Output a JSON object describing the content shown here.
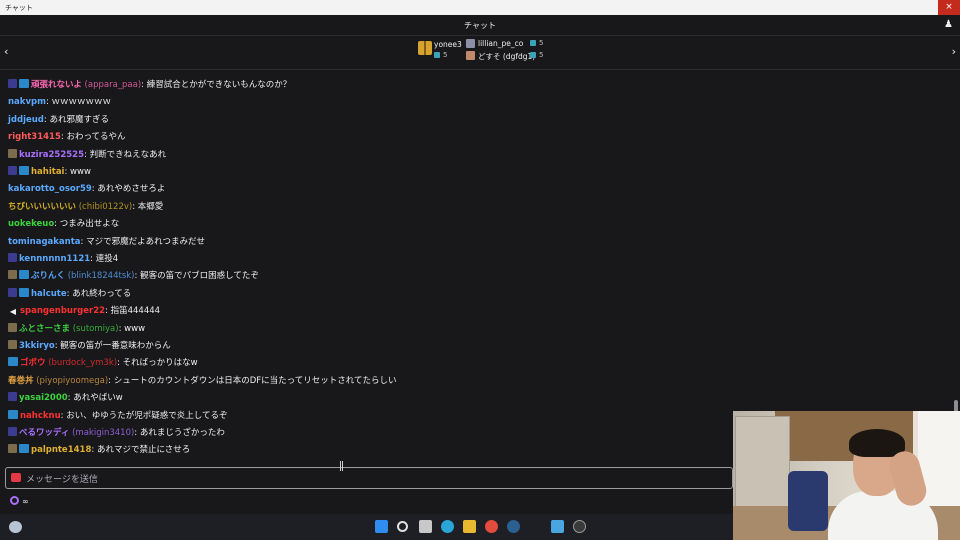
{
  "window": {
    "title": "チャット",
    "close_glyph": "×"
  },
  "header": {
    "title": "チャット",
    "users_icon": "users-icon"
  },
  "gift_bar": {
    "left_arrow": "‹",
    "right_arrow": "›",
    "gifters": [
      {
        "name": "yonee3",
        "count": "5"
      },
      {
        "name": "lillian_pe_co",
        "count": "5"
      },
      {
        "name": "どすそ (dgfdg1)",
        "count": "5"
      }
    ]
  },
  "messages": [
    {
      "user": "頑張れないよ",
      "sub": "(appara_paa)",
      "text": "練習試合とかができないもんなのか？",
      "color": "#ff69b4",
      "badges": [
        "sub-badge",
        "prime"
      ]
    },
    {
      "user": "nakvpm",
      "sub": "",
      "text": "ｗｗｗｗｗｗｗ",
      "color": "#5aa9ff",
      "badges": []
    },
    {
      "user": "jddjeud",
      "sub": "",
      "text": "あれ邪魔すぎる",
      "color": "#5aa9ff",
      "badges": []
    },
    {
      "user": "right31415",
      "sub": "",
      "text": "おわってるやん",
      "color": "#ff5a5a",
      "badges": []
    },
    {
      "user": "kuzira252525",
      "sub": "",
      "text": "判断できねえなあれ",
      "color": "#a970ff",
      "badges": [
        "img"
      ]
    },
    {
      "user": "hahitai",
      "sub": "",
      "text": "www",
      "color": "#e0b030",
      "badges": [
        "sub-badge",
        "prime"
      ]
    },
    {
      "user": "kakarotto_osor59",
      "sub": "",
      "text": "あれやめさせろよ",
      "color": "#5aa9ff",
      "badges": []
    },
    {
      "user": "ちびいいいいいい",
      "sub": "(chibi0122v)",
      "text": "本郷愛",
      "color": "#d4b020",
      "badges": []
    },
    {
      "user": "uokekeuo",
      "sub": "",
      "text": "つまみ出せよな",
      "color": "#3ed13e",
      "badges": []
    },
    {
      "user": "tominagakanta",
      "sub": "",
      "text": "マジで邪魔だよあれつまみだせ",
      "color": "#5aa9ff",
      "badges": []
    },
    {
      "user": "kennnnnn1121",
      "sub": "",
      "text": "連投4",
      "color": "#5aa9ff",
      "badges": [
        "sub-badge"
      ]
    },
    {
      "user": "ぶりんく",
      "sub": "(blink18244tsk)",
      "text": "観客の笛でパブロ困惑してたぞ",
      "color": "#5aa9ff",
      "badges": [
        "img",
        "prime"
      ]
    },
    {
      "user": "halcute",
      "sub": "",
      "text": "あれ終わってる",
      "color": "#5aa9ff",
      "badges": [
        "sub-badge",
        "prime"
      ]
    },
    {
      "user": "spangenburger22",
      "sub": "",
      "text": "指笛444444",
      "color": "#ff3030",
      "badges": [
        "speaker"
      ]
    },
    {
      "user": "ふとさーさま",
      "sub": "(sutomiya)",
      "text": "www",
      "color": "#3ed13e",
      "badges": [
        "img"
      ]
    },
    {
      "user": "3kkiryo",
      "sub": "",
      "text": "観客の笛が一番意味わからん",
      "color": "#5aa9ff",
      "badges": [
        "img"
      ]
    },
    {
      "user": "ゴボウ",
      "sub": "(burdock_ym3k)",
      "text": "そればっかりはなw",
      "color": "#ff3030",
      "badges": [
        "prime"
      ]
    },
    {
      "user": "春巻丼",
      "sub": "(piyopiyoomega)",
      "text": "シュートのカウントダウンは日本のDFに当たってリセットされてたらしい",
      "color": "#e0a040",
      "badges": []
    },
    {
      "user": "yasai2000",
      "sub": "",
      "text": "あれやばいw",
      "color": "#3ed13e",
      "badges": [
        "sub-badge"
      ]
    },
    {
      "user": "nahcknu",
      "sub": "",
      "text": "おい、ゆゆうたが児ポ疑惑で炎上してるぞ",
      "color": "#ff3030",
      "badges": [
        "prime"
      ]
    },
    {
      "user": "べるワッディ",
      "sub": "(makigin3410)",
      "text": "あれまじうざかったわ",
      "color": "#a970ff",
      "badges": [
        "sub-badge"
      ]
    },
    {
      "user": "palpnte1418",
      "sub": "",
      "text": "あれマジで禁止にさせろ",
      "color": "#e0b030",
      "badges": [
        "img",
        "prime"
      ]
    }
  ],
  "input": {
    "placeholder": "メッセージを送信",
    "emote_icon": "emote-icon"
  },
  "points": {
    "value": "∞",
    "icon": "channel-points-icon"
  },
  "taskbar": {
    "icons": [
      "start-icon",
      "search-icon",
      "task-view-icon",
      "edge-icon",
      "file-explorer-icon",
      "chrome-icon",
      "steam-icon",
      "notepad-icon",
      "obs-icon"
    ]
  },
  "colors": {
    "background": "#18181b",
    "accent": "#a970ff",
    "text": "#efeff1"
  }
}
